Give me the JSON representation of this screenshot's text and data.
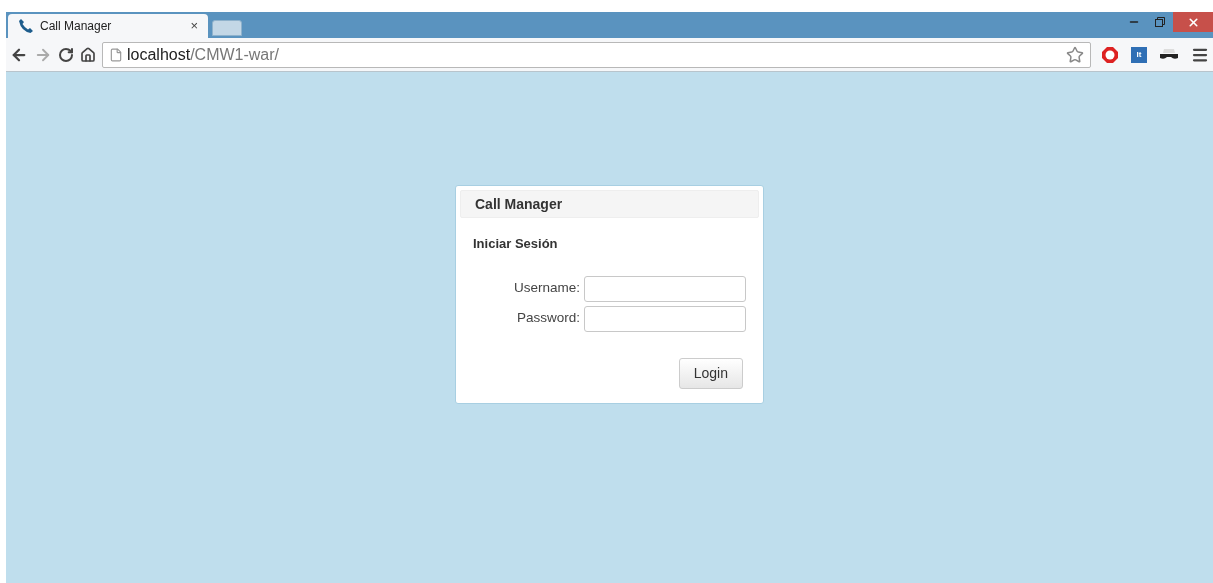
{
  "tabs": [
    {
      "title": "Call Manager",
      "close": "×",
      "selected": true
    }
  ],
  "address_bar": {
    "host": "localhost",
    "path": "/CMW1-war/"
  },
  "extensions": [
    {
      "kind": "stop"
    },
    {
      "kind": "text",
      "label": "It"
    },
    {
      "kind": "mask"
    }
  ],
  "login_panel": {
    "title": "Call Manager",
    "heading": "Iniciar Sesión",
    "fields": [
      {
        "label": "Username:"
      },
      {
        "label": "Password:"
      }
    ],
    "button": "Login"
  }
}
